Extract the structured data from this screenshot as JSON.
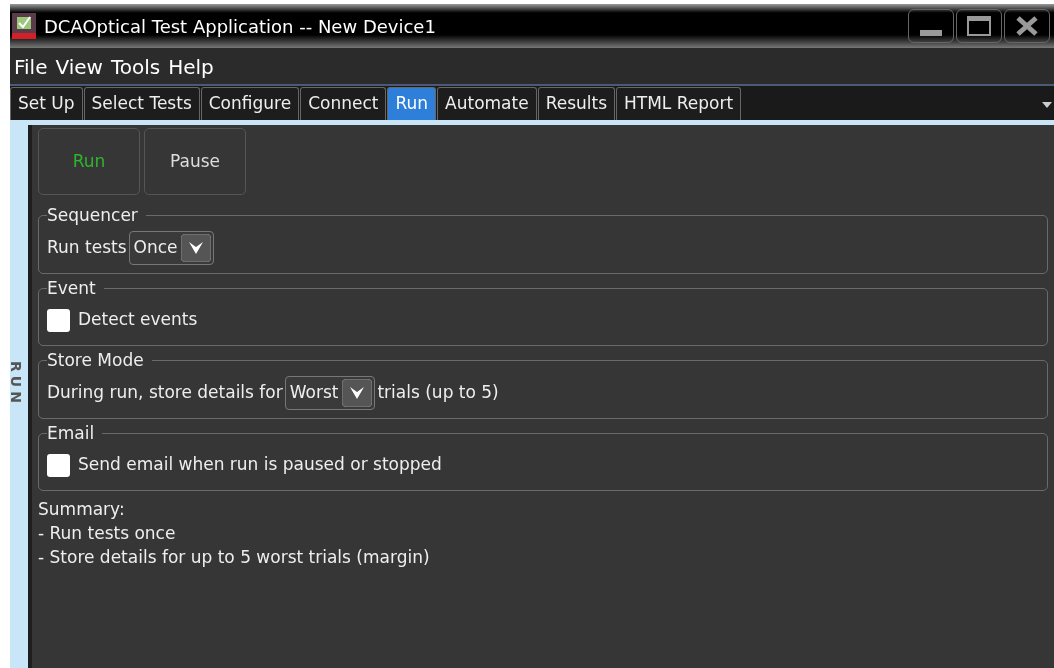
{
  "window": {
    "title": "DCAOptical Test Application -- New Device1"
  },
  "menu": [
    "File",
    "View",
    "Tools",
    "Help"
  ],
  "tabs": [
    {
      "label": "Set Up",
      "selected": false
    },
    {
      "label": "Select Tests",
      "selected": false
    },
    {
      "label": "Configure",
      "selected": false
    },
    {
      "label": "Connect",
      "selected": false
    },
    {
      "label": "Run",
      "selected": true
    },
    {
      "label": "Automate",
      "selected": false
    },
    {
      "label": "Results",
      "selected": false
    },
    {
      "label": "HTML Report",
      "selected": false
    }
  ],
  "side_label": "RUN",
  "buttons": [
    {
      "label": "Run",
      "color": "#2db52d"
    },
    {
      "label": "Pause",
      "color": "#dddddd"
    }
  ],
  "groups": [
    {
      "title": "Sequencer",
      "kind": "dropdown",
      "label": "Run tests",
      "value": "Once"
    },
    {
      "title": "Event",
      "kind": "checkbox",
      "label": "Detect events",
      "checked": false
    },
    {
      "title": "Store Mode",
      "kind": "dropdown",
      "label": "During run, store details for",
      "value": "Worst",
      "after": "trials (up to 5)"
    },
    {
      "title": "Email",
      "kind": "checkbox",
      "label": "Send email when run is paused or stopped",
      "checked": false
    }
  ],
  "summary": [
    "Summary:",
    "- Run tests once",
    "- Store details for up to 5 worst trials (margin)"
  ]
}
